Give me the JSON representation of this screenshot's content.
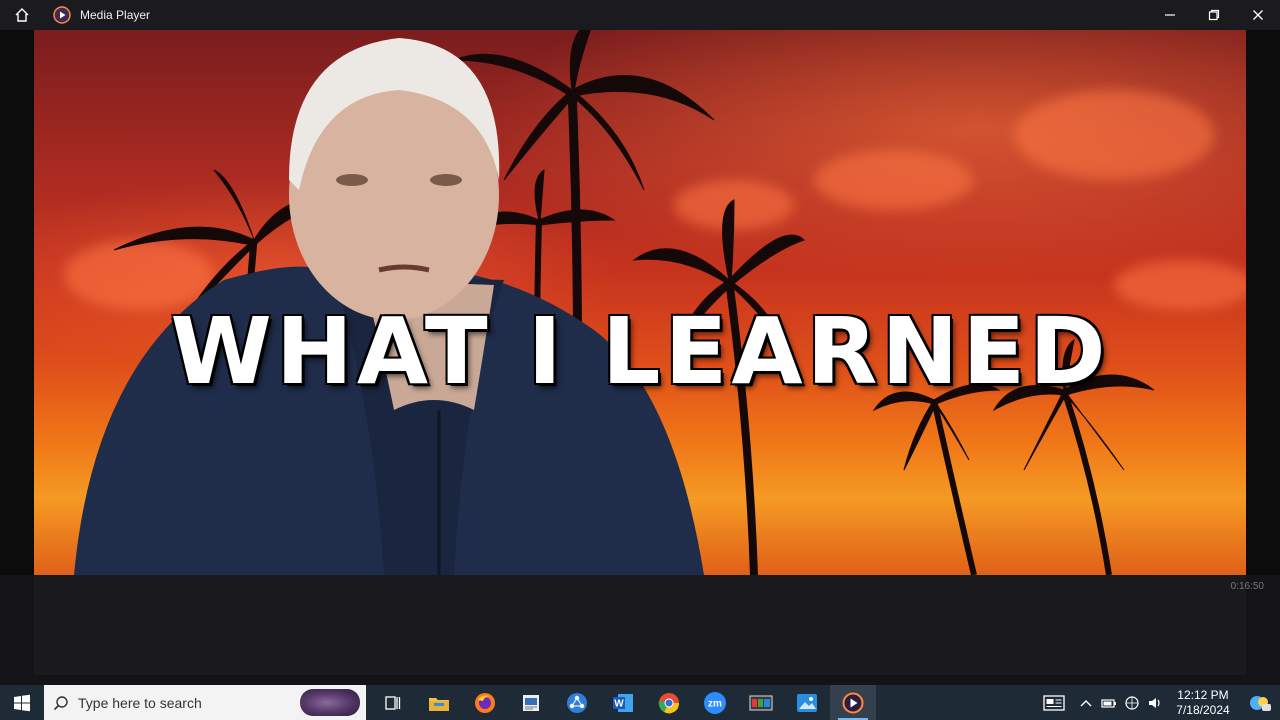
{
  "window": {
    "title": "Media Player",
    "icons": {
      "home": "home-icon",
      "app": "media-player-icon",
      "minimize": "minimize-icon",
      "maximize": "maximize-icon",
      "close": "close-icon"
    }
  },
  "video": {
    "caption": "WHAT I LEARNED",
    "timestamp": "0:16:50"
  },
  "taskbar": {
    "search_placeholder": "Type here to search",
    "apps": [
      "task-view-icon",
      "file-explorer-icon",
      "firefox-icon",
      "notepad-icon",
      "network-app-icon",
      "word-icon",
      "chrome-like-icon",
      "zoom-icon",
      "wallet-icon",
      "photos-icon",
      "media-player-icon"
    ],
    "zoom_label": "zm",
    "word_label": "W",
    "clock": {
      "time": "12:12 PM",
      "date": "7/18/2024"
    }
  },
  "colors": {
    "taskbar": "#1e2a36",
    "titlebar": "#1b1b1f",
    "accent": "#76b9ed"
  }
}
